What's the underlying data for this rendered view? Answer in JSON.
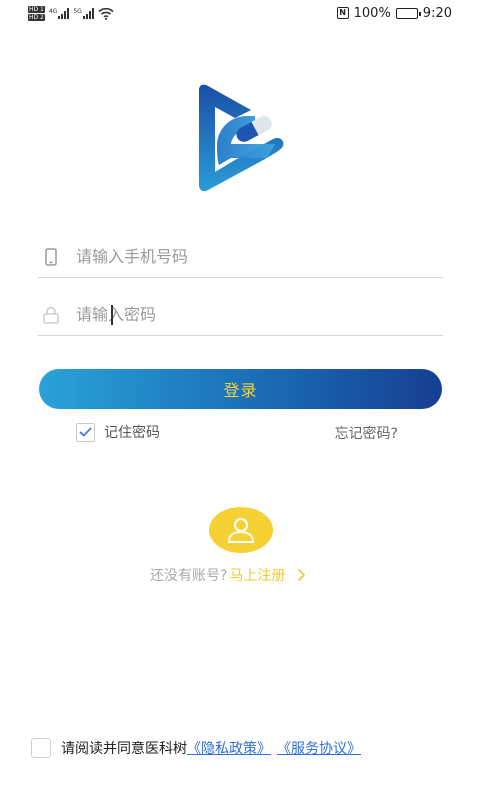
{
  "status_bar": {
    "hd_badges": [
      "HD 1",
      "HD 2"
    ],
    "network_labels": [
      "4G",
      "5G"
    ],
    "battery": "100%",
    "time": "9:20",
    "icons": [
      "hd-icon",
      "signal-icon",
      "wifi-icon",
      "nfc-icon",
      "battery-icon"
    ]
  },
  "login": {
    "phone_placeholder": "请输入手机号码",
    "phone_value": "",
    "password_placeholder": "请输入密码",
    "password_value": "",
    "login_button": "登录",
    "remember_password": "记住密码",
    "remember_checked": true,
    "forgot_password": "忘记密码?"
  },
  "register": {
    "no_account": "还没有账号?",
    "register_now": "马上注册"
  },
  "agreement": {
    "text": "请阅读并同意医科树",
    "privacy_policy": "《隐私政策》",
    "service_agreement": "《服务协议》",
    "checked": false
  },
  "colors": {
    "accent_yellow": "#f6d134",
    "button_gradient_start": "#2aa3d9",
    "button_gradient_end": "#173f92",
    "link_blue": "#2f6fd6"
  }
}
